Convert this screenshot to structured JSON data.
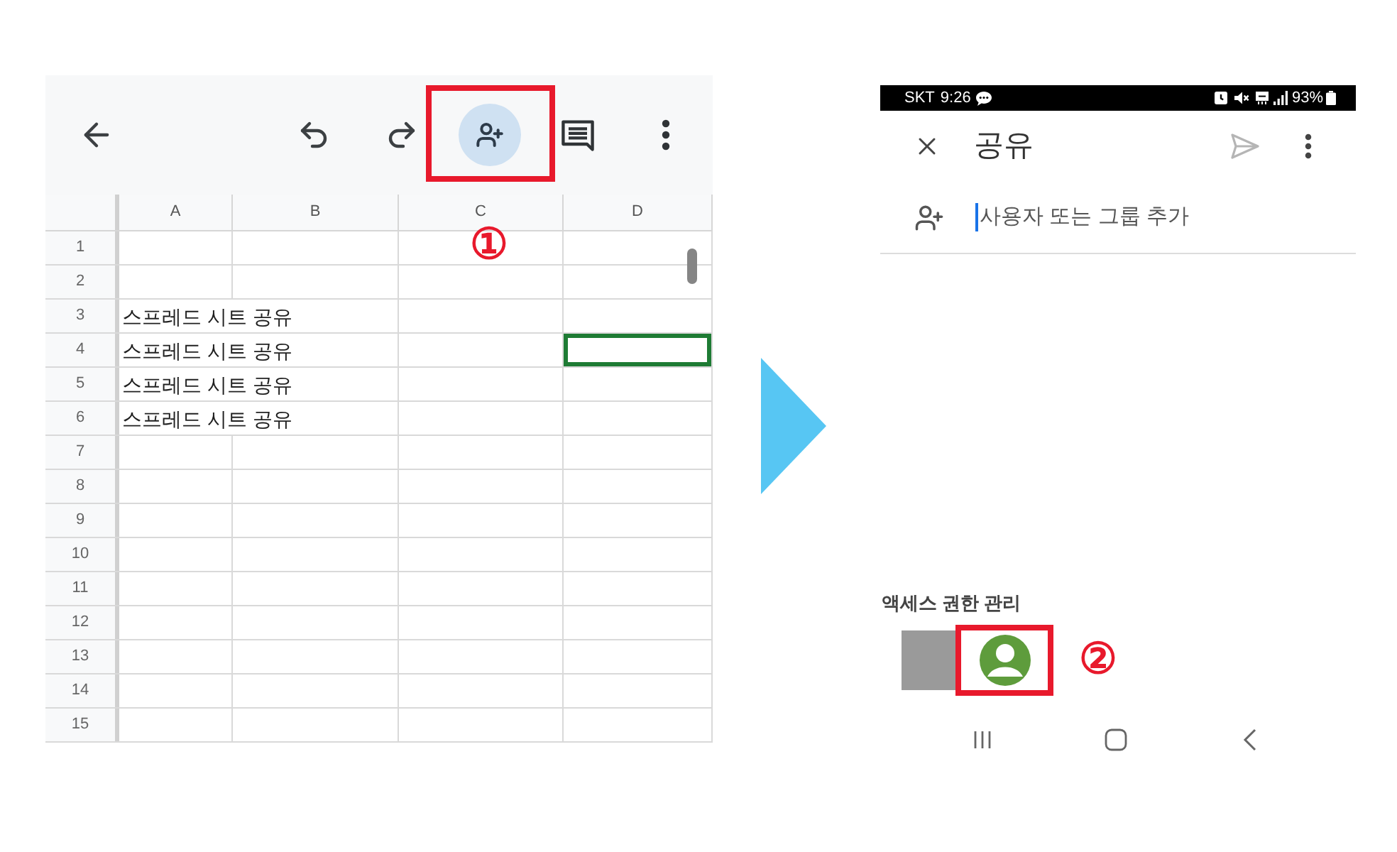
{
  "spreadsheet": {
    "toolbar": {
      "share_highlighted": true
    },
    "callout": {
      "marker": "①"
    },
    "columns": [
      "A",
      "B",
      "C",
      "D"
    ],
    "rows": [
      {
        "number": "1",
        "cells": [
          {
            "selected": false
          },
          {
            "selected": false
          },
          {
            "selected": false
          },
          {
            "selected": false
          }
        ]
      },
      {
        "number": "2",
        "cells": [
          {
            "selected": false
          },
          {
            "selected": false
          },
          {
            "selected": false
          },
          {
            "selected": false
          }
        ]
      },
      {
        "number": "3",
        "cells": [
          {
            "text": "스프레드 시트 공유",
            "selected": false
          },
          {
            "selected": false
          },
          {
            "selected": false
          },
          {
            "selected": false
          }
        ]
      },
      {
        "number": "4",
        "cells": [
          {
            "text": "스프레드 시트 공유",
            "selected": false
          },
          {
            "selected": false
          },
          {
            "selected": false
          },
          {
            "selected": true
          }
        ]
      },
      {
        "number": "5",
        "cells": [
          {
            "text": "스프레드 시트 공유",
            "selected": false
          },
          {
            "selected": false
          },
          {
            "selected": false
          },
          {
            "selected": false
          }
        ]
      },
      {
        "number": "6",
        "cells": [
          {
            "text": "스프레드 시트 공유",
            "selected": false
          },
          {
            "selected": false
          },
          {
            "selected": false
          },
          {
            "selected": false
          }
        ]
      },
      {
        "number": "7",
        "cells": [
          {
            "selected": false
          },
          {
            "selected": false
          },
          {
            "selected": false
          },
          {
            "selected": false
          }
        ]
      },
      {
        "number": "8",
        "cells": [
          {
            "selected": false
          },
          {
            "selected": false
          },
          {
            "selected": false
          },
          {
            "selected": false
          }
        ]
      },
      {
        "number": "9",
        "cells": [
          {
            "selected": false
          },
          {
            "selected": false
          },
          {
            "selected": false
          },
          {
            "selected": false
          }
        ]
      },
      {
        "number": "10",
        "cells": [
          {
            "selected": false
          },
          {
            "selected": false
          },
          {
            "selected": false
          },
          {
            "selected": false
          }
        ]
      },
      {
        "number": "11",
        "cells": [
          {
            "selected": false
          },
          {
            "selected": false
          },
          {
            "selected": false
          },
          {
            "selected": false
          }
        ]
      },
      {
        "number": "12",
        "cells": [
          {
            "selected": false
          },
          {
            "selected": false
          },
          {
            "selected": false
          },
          {
            "selected": false
          }
        ]
      },
      {
        "number": "13",
        "cells": [
          {
            "selected": false
          },
          {
            "selected": false
          },
          {
            "selected": false
          },
          {
            "selected": false
          }
        ]
      },
      {
        "number": "14",
        "cells": [
          {
            "selected": false
          },
          {
            "selected": false
          },
          {
            "selected": false
          },
          {
            "selected": false
          }
        ]
      },
      {
        "number": "15",
        "cells": [
          {
            "selected": false
          },
          {
            "selected": false
          },
          {
            "selected": false
          },
          {
            "selected": false
          }
        ]
      }
    ]
  },
  "phone": {
    "status_bar": {
      "carrier": "SKT",
      "time": "9:26",
      "battery": "93%"
    },
    "header": {
      "title": "공유",
      "send_disabled": true
    },
    "add_people": {
      "placeholder": "사용자 또는 그룹 추가",
      "focused": true
    },
    "access": {
      "label": "액세스 권한 관리"
    },
    "callout": {
      "marker": "②"
    }
  }
}
